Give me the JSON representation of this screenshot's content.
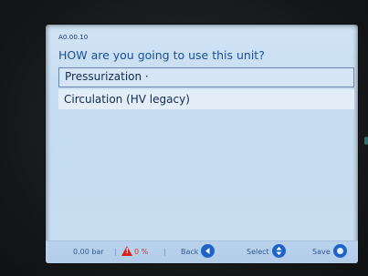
{
  "screen": {
    "id": "A0.00.10",
    "question": "HOW are you going to use this unit?"
  },
  "options": [
    {
      "label": "Pressurization ·",
      "selected": true
    },
    {
      "label": "Circulation (HV legacy)",
      "selected": false
    }
  ],
  "footer": {
    "pressure": "0.00 bar",
    "separator": "|",
    "alarm_pct": "0 %",
    "back_label": "Back",
    "select_label": "Select",
    "save_label": "Save"
  },
  "icons": {
    "alarm": "warning-triangle-icon",
    "back": "left-arrow-circle-icon",
    "select": "up-down-circle-icon",
    "save": "ring-circle-icon"
  },
  "colors": {
    "accent": "#1f63c7",
    "warning": "#d42424",
    "text_primary": "#1a4f97"
  }
}
